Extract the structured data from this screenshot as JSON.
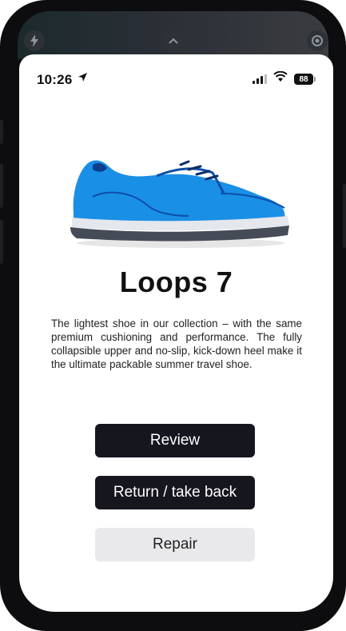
{
  "status_bar": {
    "time": "10:26",
    "location_icon": "location-arrow-icon",
    "signal_icon": "cellular-signal-icon",
    "wifi_icon": "wifi-icon",
    "battery_level": "88"
  },
  "hardware_icons": {
    "left": "flash-icon",
    "center": "chevron-up-icon",
    "right": "camera-icon"
  },
  "product": {
    "image_icon": "sneaker-image",
    "title": "Loops 7",
    "description": "The lightest shoe in our collection – with the same premium cushioning and performance. The fully collapsible upper and no-slip, kick-down heel make it the ultimate packable summer travel shoe."
  },
  "actions": {
    "review_label": "Review",
    "return_label": "Return / take back",
    "repair_label": "Repair"
  },
  "colors": {
    "button_dark": "#16161f",
    "button_light": "#e9e9eb",
    "shoe_blue": "#1a8fe6",
    "phone_frame": "#0d0d0f"
  }
}
